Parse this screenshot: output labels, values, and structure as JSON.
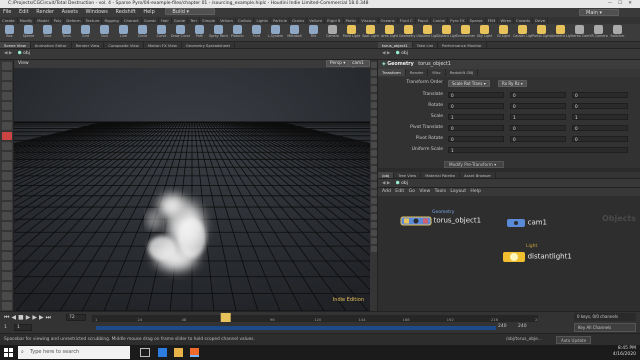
{
  "window": {
    "title": "C:/Projects/CGCircuit/Total Destruction - vol. 4 - Sparse Pyro/04-example-files/chapter 01 - /sourcing_example.hiplc - Houdini Indie Limited-Commercial 18.0.348",
    "controls": [
      "—",
      "☐",
      "✕"
    ]
  },
  "menu": {
    "items": [
      "File",
      "Edit",
      "Render",
      "Assets",
      "Windows",
      "Redshift",
      "Help"
    ],
    "build_label": "Build",
    "main_label": "Main"
  },
  "shelf": {
    "tabs": [
      "Create",
      "Modify",
      "Model",
      "Poly",
      "Deform",
      "Texture",
      "Rigging",
      "Charact",
      "Constr",
      "Hair",
      "Guide",
      "Terr",
      "Simple",
      "Vellum",
      "Collisio",
      "Lights",
      "Particle",
      "Grains",
      "Vellum",
      "Rigid B",
      "Partic",
      "Viscous",
      "Oceans",
      "Fluid C",
      "Popul",
      "Contai",
      "Pyro FX",
      "Sparse",
      "FEM",
      "Wires",
      "Crowds",
      "Drive"
    ],
    "tools": [
      {
        "label": "Box",
        "color": "#8da7c4"
      },
      {
        "label": "Sphere",
        "color": "#8da7c4"
      },
      {
        "label": "Tube",
        "color": "#8da7c4"
      },
      {
        "label": "Torus",
        "color": "#8da7c4"
      },
      {
        "label": "Grid",
        "color": "#8da7c4"
      },
      {
        "label": "Null",
        "color": "#8da7c4"
      },
      {
        "label": "Line",
        "color": "#8da7c4"
      },
      {
        "label": "Circle",
        "color": "#8da7c4"
      },
      {
        "label": "Curve",
        "color": "#8da7c4"
      },
      {
        "label": "Draw Curve",
        "color": "#8da7c4"
      },
      {
        "label": "Path",
        "color": "#8da7c4"
      },
      {
        "label": "Spray Paint",
        "color": "#8da7c4"
      },
      {
        "label": "Platonic",
        "color": "#8da7c4"
      },
      {
        "label": "Font",
        "color": "#8da7c4"
      },
      {
        "label": "L-System",
        "color": "#8da7c4"
      },
      {
        "label": "Metaball",
        "color": "#8da7c4"
      },
      {
        "label": "File",
        "color": "#8da7c4"
      },
      {
        "label": "Camera",
        "color": "#aaaaaa"
      },
      {
        "label": "Point Light",
        "color": "#e8c25a"
      },
      {
        "label": "Spot Light",
        "color": "#e8c25a"
      },
      {
        "label": "Area Light",
        "color": "#e8c25a"
      },
      {
        "label": "Geometry Light",
        "color": "#e8c25a"
      },
      {
        "label": "Volume Light",
        "color": "#e8c25a"
      },
      {
        "label": "Distant Light",
        "color": "#e8c25a"
      },
      {
        "label": "Environment Light",
        "color": "#e8c25a"
      },
      {
        "label": "Sky Light",
        "color": "#e8c25a"
      },
      {
        "label": "GI Light",
        "color": "#e8c25a"
      },
      {
        "label": "Caustic Light",
        "color": "#e8c25a"
      },
      {
        "label": "Portal Light",
        "color": "#e8c25a"
      },
      {
        "label": "Ambient Light",
        "color": "#e8c25a"
      },
      {
        "label": "Stereo Camera",
        "color": "#aaaaaa"
      },
      {
        "label": "VR Camera",
        "color": "#aaaaaa"
      },
      {
        "label": "Switcher",
        "color": "#aaaaaa"
      }
    ]
  },
  "left_pane": {
    "tabs": [
      "Scene View",
      "Animation Editor",
      "Render View",
      "Composite View",
      "Motion FX View",
      "Geometry Spreadsheet"
    ],
    "path": "obj",
    "view_label": "View",
    "persp_label": "Persp",
    "cam_label": "cam1",
    "watermark": "Indie Edition"
  },
  "right_pane": {
    "tabs": [
      "torus_object1",
      "Take List",
      "Performance Monitor"
    ],
    "path": "obj",
    "node_type": "Geometry",
    "node_name": "torus_object1",
    "param_tabs": [
      "Transform",
      "Render",
      "Misc",
      "Redshift OBJ"
    ],
    "transform_order_label": "Transform Order",
    "transform_order_value": "Scale Rot Trans",
    "rot_order_value": "Rx Ry Rz",
    "rows": [
      {
        "label": "Translate",
        "values": [
          "0",
          "0",
          "0"
        ]
      },
      {
        "label": "Rotate",
        "values": [
          "0",
          "0",
          "0"
        ]
      },
      {
        "label": "Scale",
        "values": [
          "1",
          "1",
          "1"
        ]
      },
      {
        "label": "Pivot Translate",
        "values": [
          "0",
          "0",
          "0"
        ]
      },
      {
        "label": "Pivot Rotate",
        "values": [
          "0",
          "0",
          "0"
        ]
      },
      {
        "label": "Uniform Scale",
        "values": [
          "1"
        ]
      }
    ],
    "modify_label": "Modify Pre-Transform"
  },
  "network": {
    "tabs": [
      "/obj",
      "Tree View",
      "Material Palette",
      "Asset Browser"
    ],
    "path": "obj",
    "menu": [
      "Add",
      "Edit",
      "Go",
      "View",
      "Tools",
      "Layout",
      "Help"
    ],
    "context_label": "Objects",
    "nodes": [
      {
        "type": "Geometry",
        "name": "torus_object1",
        "color": "#5a8ad8"
      },
      {
        "type": "",
        "name": "cam1",
        "color": "#5a8ad8"
      },
      {
        "type": "Light",
        "name": "distantlight1",
        "color": "#f0c030"
      }
    ]
  },
  "timeline": {
    "current_frame": "72",
    "start_label": "1",
    "start_value": "1",
    "end_value": "240",
    "end_value2": "240",
    "ticks": [
      "1",
      "24",
      "48",
      "72",
      "96",
      "120",
      "144",
      "168",
      "192",
      "216",
      "240"
    ],
    "keys_label": "0 keys, 0/0 channels",
    "all_channels_label": "Key All Channels",
    "auto_update_label": "Auto Update",
    "path_label": "/obj/torus_obje..."
  },
  "status": {
    "text": "Spacebar for viewing and unrestricted scrubbing. Middle mouse drag on frame slider to hold scoped channel values."
  },
  "taskbar": {
    "search_placeholder": "Type here to search",
    "time": "8:45 PM",
    "date": "4/16/2020"
  }
}
